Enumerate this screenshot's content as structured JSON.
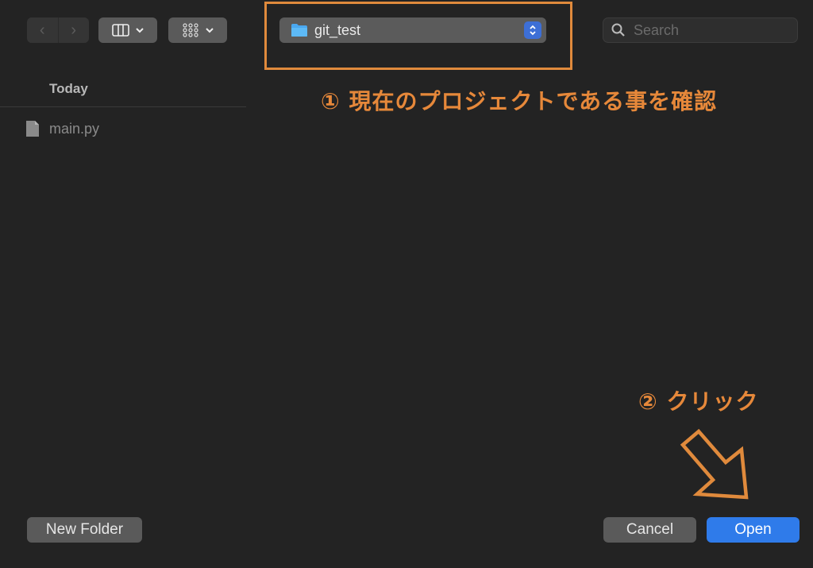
{
  "toolbar": {
    "back_glyph": "‹",
    "forward_glyph": "›",
    "view_mode_icon": "columns-icon",
    "group_icon": "grid-icon",
    "path_popup": {
      "label": "git_test",
      "icon": "folder-icon"
    },
    "search": {
      "placeholder": "Search",
      "value": ""
    }
  },
  "sidebar": {
    "section_header": "Today",
    "files": [
      {
        "name": "main.py",
        "icon": "document-icon"
      }
    ]
  },
  "annotations": {
    "step1": "① 現在のプロジェクトである事を確認",
    "step2": "② クリック",
    "color": "#e6883a"
  },
  "buttons": {
    "new_folder": "New Folder",
    "cancel": "Cancel",
    "open": "Open"
  },
  "colors": {
    "background": "#232323",
    "accent": "#2f7bea",
    "annotation": "#e08a3c"
  }
}
